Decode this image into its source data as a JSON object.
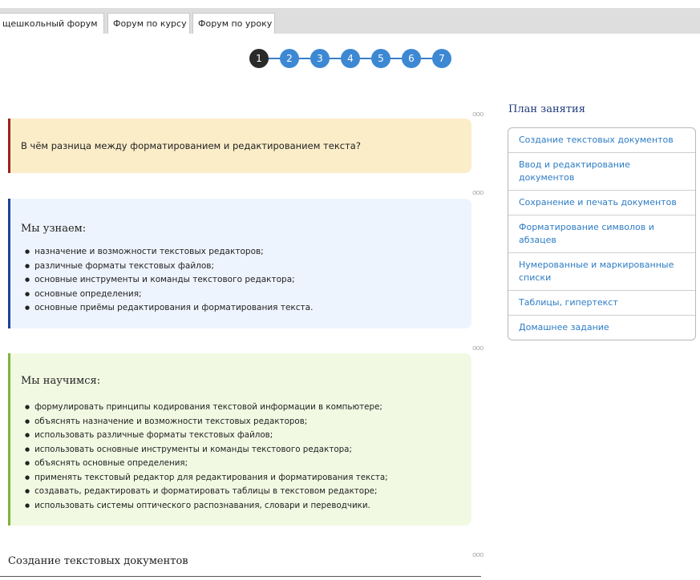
{
  "tabs": [
    {
      "label": "щешкольный форум"
    },
    {
      "label": "Форум по курсу"
    },
    {
      "label": "Форум по уроку"
    }
  ],
  "pager": {
    "pages": [
      "1",
      "2",
      "3",
      "4",
      "5",
      "6",
      "7"
    ],
    "current": "1"
  },
  "question": {
    "text": "В чём разница между форматированием и редактированием текста?"
  },
  "learn": {
    "title": "Мы узнаем:",
    "items": [
      "назначение и возможности текстовых редакторов;",
      "различные форматы текстовых файлов;",
      "основные инструменты и команды текстового редактора;",
      "основные определения;",
      "основные приёмы редактирования и форматирования текста."
    ]
  },
  "skills": {
    "title": "Мы научимся:",
    "items": [
      "формулировать принципы кодирования текстовой информации в компьютере;",
      "объяснять назначение и возможности текстовых редакторов;",
      "использовать различные форматы текстовых файлов;",
      "использовать основные инструменты и команды текстового редактора;",
      "объяснять основные определения;",
      "применять текстовый редактор для редактирования и форматирования текста;",
      "создавать, редактировать и форматировать таблицы в текстовом редакторе;",
      "использовать системы оптического распознавания, словари и переводчики."
    ]
  },
  "plan": {
    "title": "План занятия",
    "items": [
      "Создание текстовых документов",
      "Ввод и редактирование документов",
      "Сохранение и печать документов",
      "Форматирование символов и абзацев",
      "Нумерованные и маркированные списки",
      "Таблицы, гипертекст",
      "Домашнее задание"
    ]
  },
  "section": {
    "title": "Создание текстовых документов"
  },
  "colors": {
    "accent": "#3d88d3",
    "active_page": "#2a2a2a",
    "question_bg": "#fbedc8",
    "question_border": "#9b2222",
    "learn_bg": "#eef4fd",
    "learn_border": "#1f3f9f",
    "skills_bg": "#f2f9e3",
    "skills_border": "#7fb43d",
    "plan_title": "#1e3a7b",
    "link": "#2d7cc4"
  }
}
